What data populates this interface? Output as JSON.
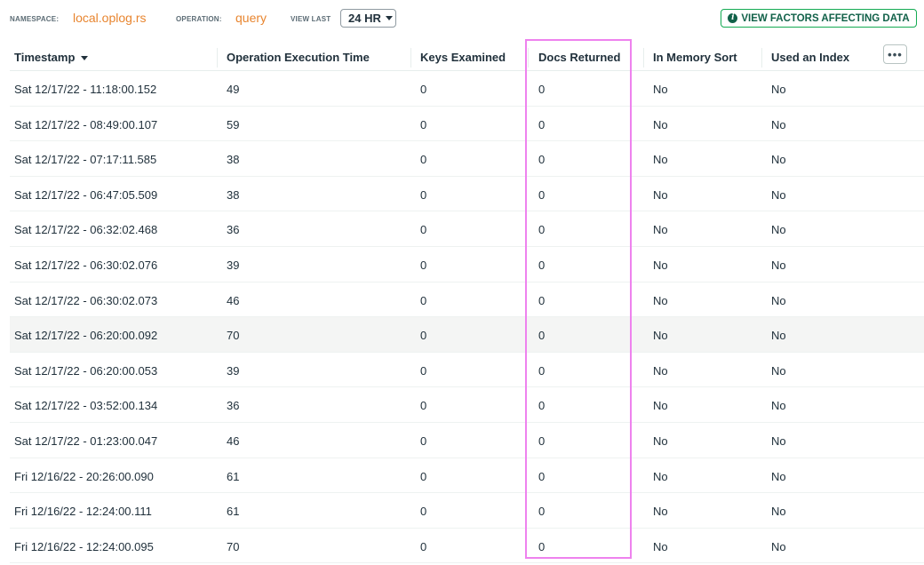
{
  "filters": {
    "namespace_label": "NAMESPACE:",
    "namespace_value": "local.oplog.rs",
    "operation_label": "OPERATION:",
    "operation_value": "query",
    "view_last_label": "VIEW LAST",
    "view_last_value": "24 HR",
    "factors_button": "VIEW FACTORS AFFECTING DATA",
    "info_icon": "i"
  },
  "table": {
    "columns": [
      "Timestamp",
      "Operation Execution Time",
      "Keys Examined",
      "Docs Returned",
      "In Memory Sort",
      "Used an Index"
    ],
    "more_label": "•••",
    "highlighted_column": "Docs Returned",
    "rows": [
      [
        "Sat 12/17/22 - 11:18:00.152",
        "49",
        "0",
        "0",
        "No",
        "No"
      ],
      [
        "Sat 12/17/22 - 08:49:00.107",
        "59",
        "0",
        "0",
        "No",
        "No"
      ],
      [
        "Sat 12/17/22 - 07:17:11.585",
        "38",
        "0",
        "0",
        "No",
        "No"
      ],
      [
        "Sat 12/17/22 - 06:47:05.509",
        "38",
        "0",
        "0",
        "No",
        "No"
      ],
      [
        "Sat 12/17/22 - 06:32:02.468",
        "36",
        "0",
        "0",
        "No",
        "No"
      ],
      [
        "Sat 12/17/22 - 06:30:02.076",
        "39",
        "0",
        "0",
        "No",
        "No"
      ],
      [
        "Sat 12/17/22 - 06:30:02.073",
        "46",
        "0",
        "0",
        "No",
        "No"
      ],
      [
        "Sat 12/17/22 - 06:20:00.092",
        "70",
        "0",
        "0",
        "No",
        "No"
      ],
      [
        "Sat 12/17/22 - 06:20:00.053",
        "39",
        "0",
        "0",
        "No",
        "No"
      ],
      [
        "Sat 12/17/22 - 03:52:00.134",
        "36",
        "0",
        "0",
        "No",
        "No"
      ],
      [
        "Sat 12/17/22 - 01:23:00.047",
        "46",
        "0",
        "0",
        "No",
        "No"
      ],
      [
        "Fri 12/16/22 - 20:26:00.090",
        "61",
        "0",
        "0",
        "No",
        "No"
      ],
      [
        "Fri 12/16/22 - 12:24:00.111",
        "61",
        "0",
        "0",
        "No",
        "No"
      ],
      [
        "Fri 12/16/22 - 12:24:00.095",
        "70",
        "0",
        "0",
        "No",
        "No"
      ]
    ]
  },
  "colors": {
    "accent_orange": "#e8852f",
    "button_green": "#116149",
    "highlight_border": "#ee82ee"
  }
}
